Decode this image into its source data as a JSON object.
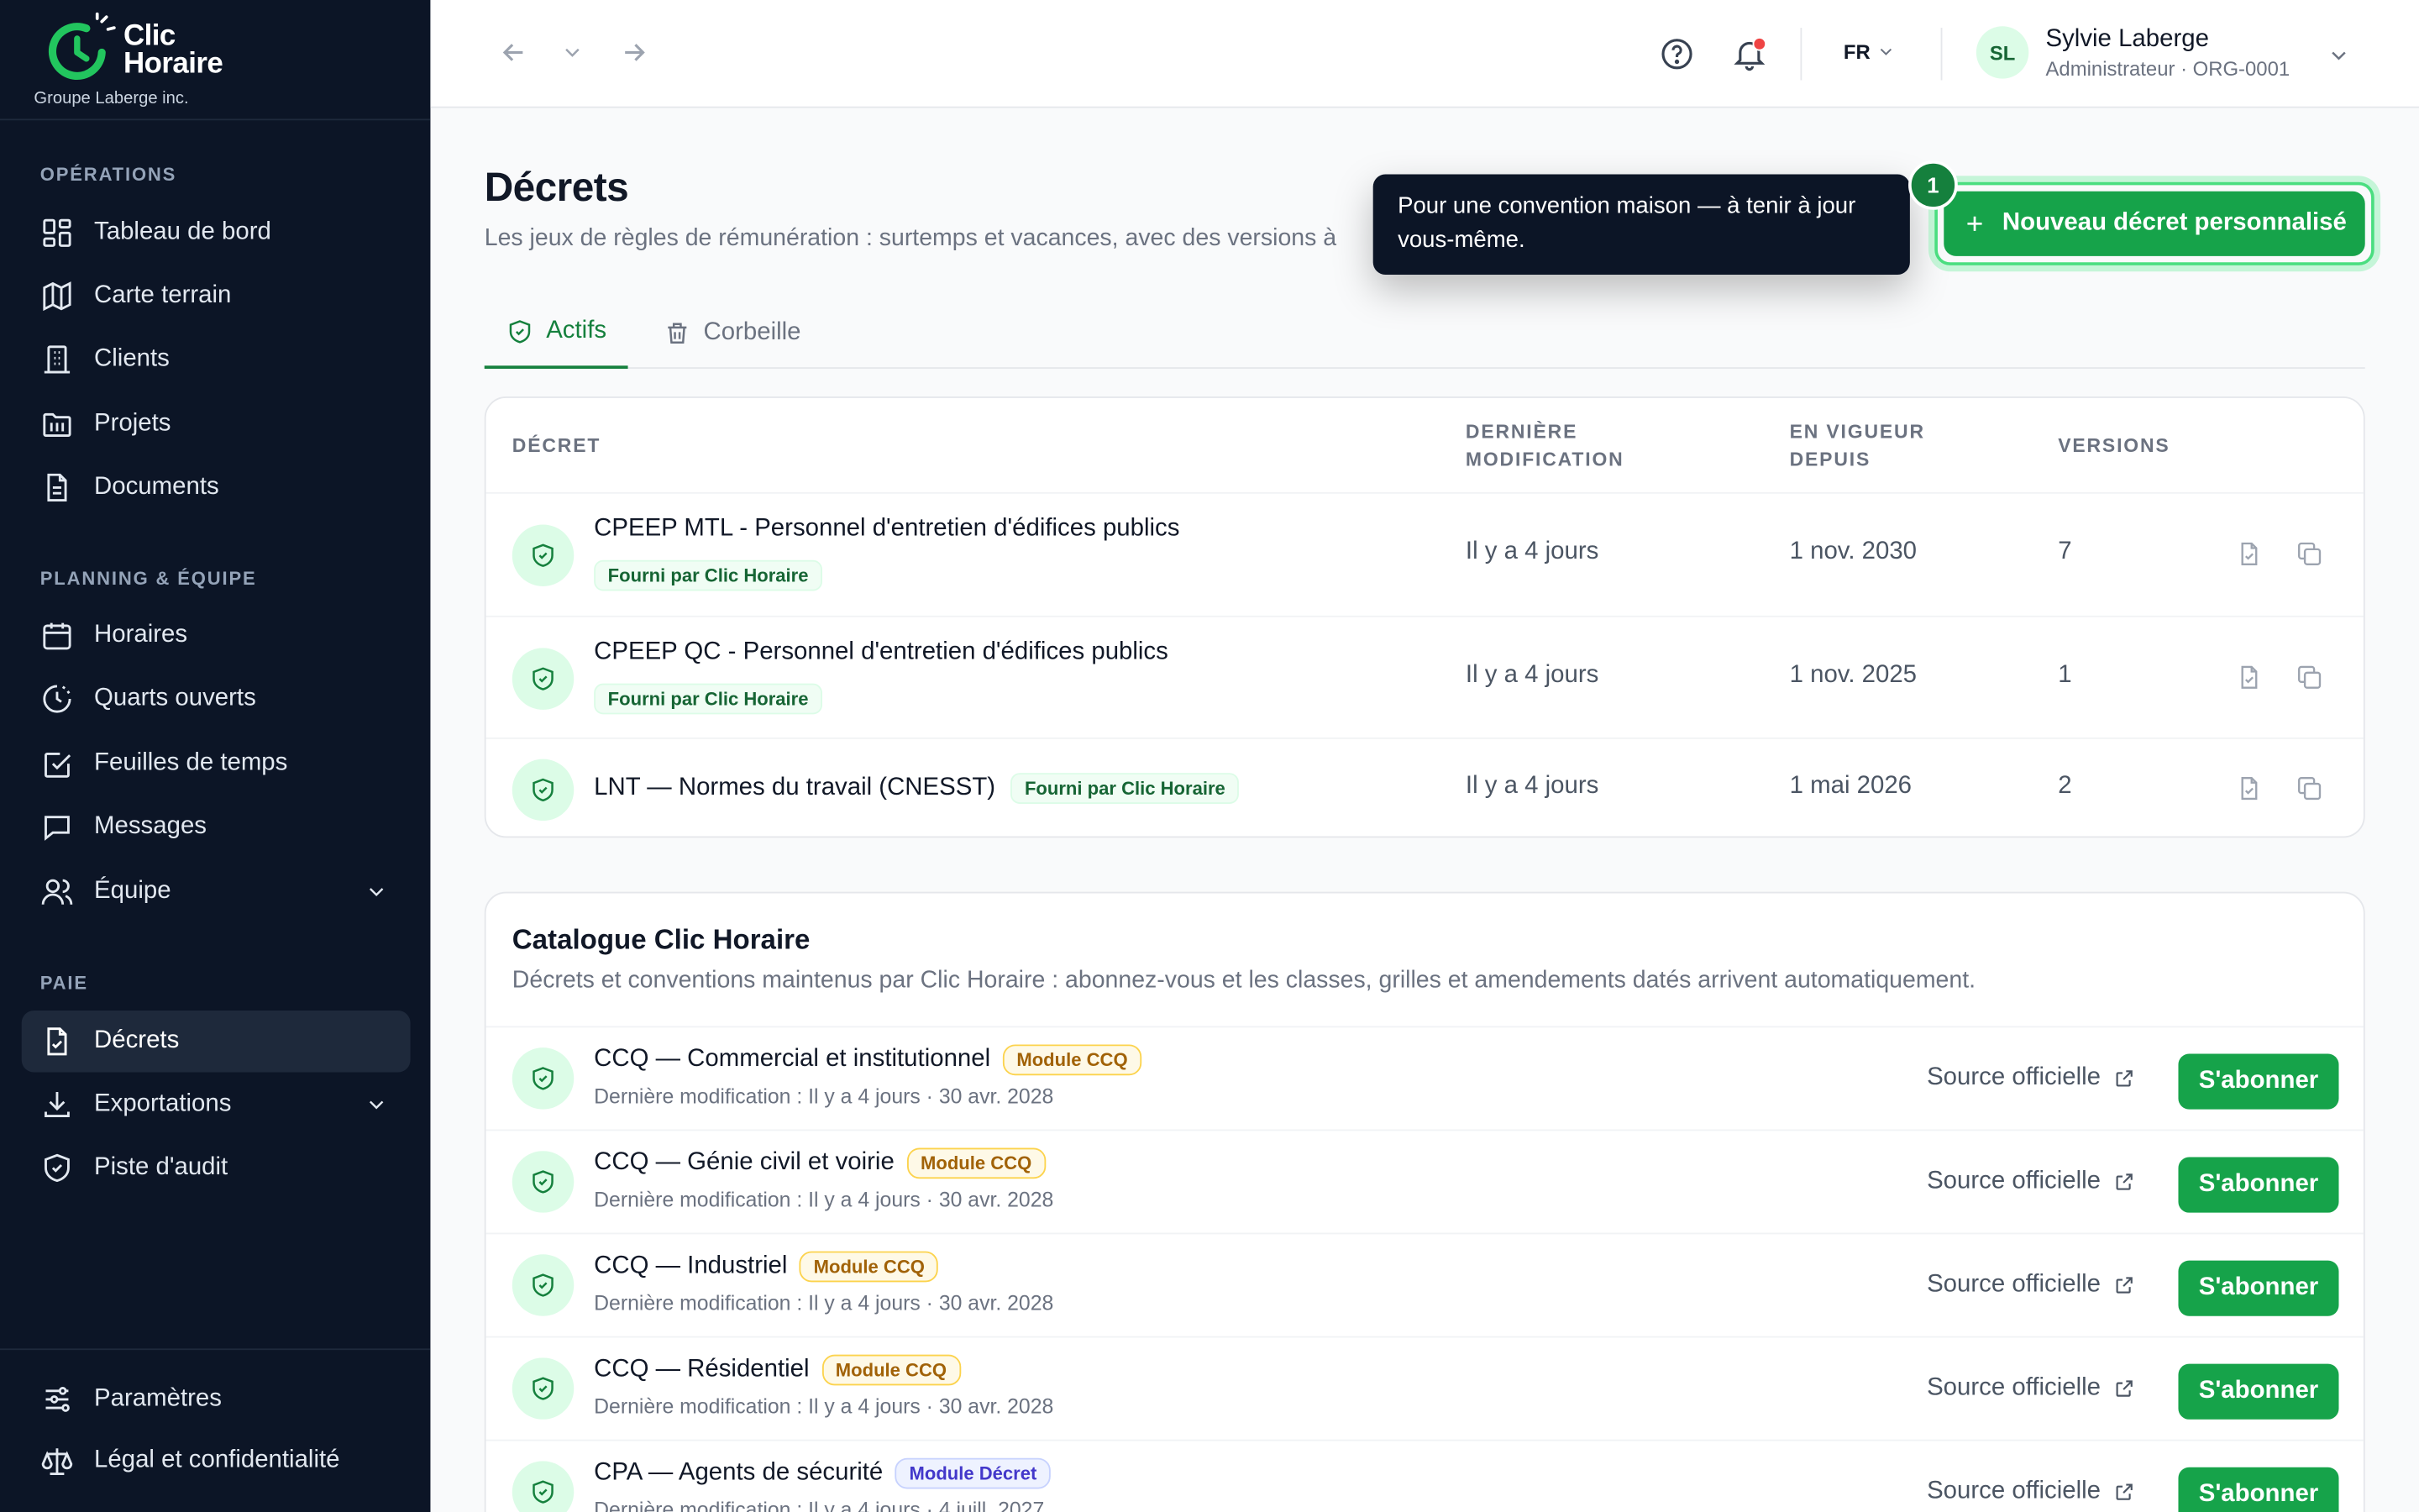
{
  "brand": {
    "name_line1": "Clic",
    "name_line2": "Horaire",
    "org": "Groupe Laberge inc.",
    "accent": "#22c55e"
  },
  "sidebar": {
    "sections": {
      "operations": "OPÉRATIONS",
      "planning": "PLANNING & ÉQUIPE",
      "paie": "PAIE"
    },
    "items": {
      "tableau": "Tableau de bord",
      "carte": "Carte terrain",
      "clients": "Clients",
      "projets": "Projets",
      "documents": "Documents",
      "horaires": "Horaires",
      "quarts": "Quarts ouverts",
      "feuilles": "Feuilles de temps",
      "messages": "Messages",
      "equipe": "Équipe",
      "decrets": "Décrets",
      "exportations": "Exportations",
      "audit": "Piste d'audit",
      "parametres": "Paramètres",
      "legal": "Légal et confidentialité"
    }
  },
  "topbar": {
    "lang": "FR",
    "user_initials": "SL",
    "user_name": "Sylvie Laberge",
    "user_role": "Administrateur · ORG-0001"
  },
  "page": {
    "title": "Décrets",
    "subtitle": "Les jeux de règles de rémunération : surtemps et vacances, avec des versions à",
    "tooltip": "Pour une convention maison — à tenir à jour vous-même.",
    "step": "1",
    "new_button": "Nouveau décret personnalisé",
    "tabs": {
      "active": "Actifs",
      "trash": "Corbeille"
    }
  },
  "table": {
    "headers": {
      "decret": "DÉCRET",
      "modif_1": "DERNIÈRE",
      "modif_2": "MODIFICATION",
      "vigueur_1": "EN VIGUEUR",
      "vigueur_2": "DEPUIS",
      "versions": "VERSIONS"
    },
    "rows": [
      {
        "name": "CPEEP MTL - Personnel d'entretien d'édifices publics",
        "tag": "Fourni par Clic Horaire",
        "modified": "Il y a 4 jours",
        "since": "1 nov. 2030",
        "versions": "7"
      },
      {
        "name": "CPEEP QC - Personnel d'entretien d'édifices publics",
        "tag": "Fourni par Clic Horaire",
        "modified": "Il y a 4 jours",
        "since": "1 nov. 2025",
        "versions": "1"
      },
      {
        "name": "LNT — Normes du travail (CNESST)",
        "tag": "Fourni par Clic Horaire",
        "modified": "Il y a 4 jours",
        "since": "1 mai 2026",
        "versions": "2"
      }
    ]
  },
  "catalogue": {
    "title": "Catalogue Clic Horaire",
    "subtitle": "Décrets et conventions maintenus par Clic Horaire : abonnez-vous et les classes, grilles et amendements datés arrivent automatiquement.",
    "source_label": "Source officielle",
    "subscribe_label": "S'abonner",
    "items": [
      {
        "name": "CCQ — Commercial et institutionnel",
        "tag": "Module CCQ",
        "meta": "Dernière modification : Il y a 4 jours · 30 avr. 2028"
      },
      {
        "name": "CCQ — Génie civil et voirie",
        "tag": "Module CCQ",
        "meta": "Dernière modification : Il y a 4 jours · 30 avr. 2028"
      },
      {
        "name": "CCQ — Industriel",
        "tag": "Module CCQ",
        "meta": "Dernière modification : Il y a 4 jours · 30 avr. 2028"
      },
      {
        "name": "CCQ — Résidentiel",
        "tag": "Module CCQ",
        "meta": "Dernière modification : Il y a 4 jours · 30 avr. 2028"
      },
      {
        "name": "CPA — Agents de sécurité",
        "tag": "Module Décret",
        "meta": "Dernière modification : Il y a 4 jours · 4 juill. 2027"
      }
    ]
  }
}
